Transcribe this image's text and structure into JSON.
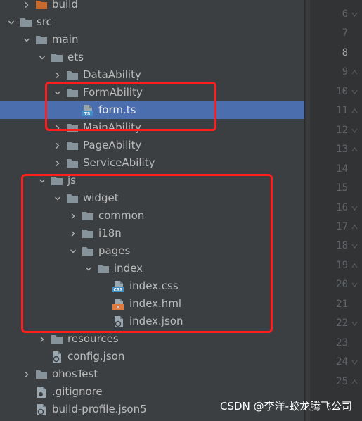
{
  "project_tree": {
    "rows": [
      {
        "label": "build",
        "depth": 1,
        "kind": "folder-orange",
        "expanded": false,
        "arrow": true
      },
      {
        "label": "src",
        "depth": 0,
        "kind": "folder",
        "expanded": true,
        "arrow": true
      },
      {
        "label": "main",
        "depth": 1,
        "kind": "folder",
        "expanded": true,
        "arrow": true
      },
      {
        "label": "ets",
        "depth": 2,
        "kind": "folder",
        "expanded": true,
        "arrow": true
      },
      {
        "label": "DataAbility",
        "depth": 3,
        "kind": "folder",
        "expanded": false,
        "arrow": true
      },
      {
        "label": "FormAbility",
        "depth": 3,
        "kind": "folder",
        "expanded": true,
        "arrow": true
      },
      {
        "label": "form.ts",
        "depth": 4,
        "kind": "file-ts",
        "expanded": false,
        "arrow": false,
        "selected": true
      },
      {
        "label": "MainAbility",
        "depth": 3,
        "kind": "folder",
        "expanded": false,
        "arrow": true
      },
      {
        "label": "PageAbility",
        "depth": 3,
        "kind": "folder",
        "expanded": false,
        "arrow": true
      },
      {
        "label": "ServiceAbility",
        "depth": 3,
        "kind": "folder",
        "expanded": false,
        "arrow": true
      },
      {
        "label": "js",
        "depth": 2,
        "kind": "folder",
        "expanded": true,
        "arrow": true
      },
      {
        "label": "widget",
        "depth": 3,
        "kind": "folder",
        "expanded": true,
        "arrow": true
      },
      {
        "label": "common",
        "depth": 4,
        "kind": "folder",
        "expanded": false,
        "arrow": true
      },
      {
        "label": "i18n",
        "depth": 4,
        "kind": "folder",
        "expanded": false,
        "arrow": true
      },
      {
        "label": "pages",
        "depth": 4,
        "kind": "folder",
        "expanded": true,
        "arrow": true
      },
      {
        "label": "index",
        "depth": 5,
        "kind": "folder",
        "expanded": true,
        "arrow": true
      },
      {
        "label": "index.css",
        "depth": 6,
        "kind": "file-css",
        "expanded": false,
        "arrow": false
      },
      {
        "label": "index.hml",
        "depth": 6,
        "kind": "file-hml",
        "expanded": false,
        "arrow": false
      },
      {
        "label": "index.json",
        "depth": 6,
        "kind": "file-json",
        "expanded": false,
        "arrow": false
      },
      {
        "label": "resources",
        "depth": 2,
        "kind": "folder",
        "expanded": false,
        "arrow": true
      },
      {
        "label": "config.json",
        "depth": 2,
        "kind": "file-json",
        "expanded": false,
        "arrow": false
      },
      {
        "label": "ohosTest",
        "depth": 1,
        "kind": "folder",
        "expanded": false,
        "arrow": true
      },
      {
        "label": ".gitignore",
        "depth": 1,
        "kind": "file-plain",
        "expanded": false,
        "arrow": false
      },
      {
        "label": "build-profile.json5",
        "depth": 1,
        "kind": "file-json",
        "expanded": false,
        "arrow": false
      }
    ],
    "icon_badges": {
      "ts": "TS",
      "css": "CSS",
      "hml": "H"
    }
  },
  "gutter": {
    "line_numbers": [
      "6",
      "7",
      "8",
      "9",
      "10",
      "11",
      "12",
      "13",
      "14",
      "15",
      "16",
      "17",
      "18",
      "19",
      "20",
      "21",
      "22",
      "23",
      "24",
      "25"
    ],
    "active_line": "8"
  },
  "colors": {
    "selection": "#4b6eaf",
    "annotation_box": "#ff1d1d",
    "folder": "#87939a",
    "build_folder": "#c7692d"
  },
  "watermark": "CSDN @李洋-蛟龙腾飞公司"
}
